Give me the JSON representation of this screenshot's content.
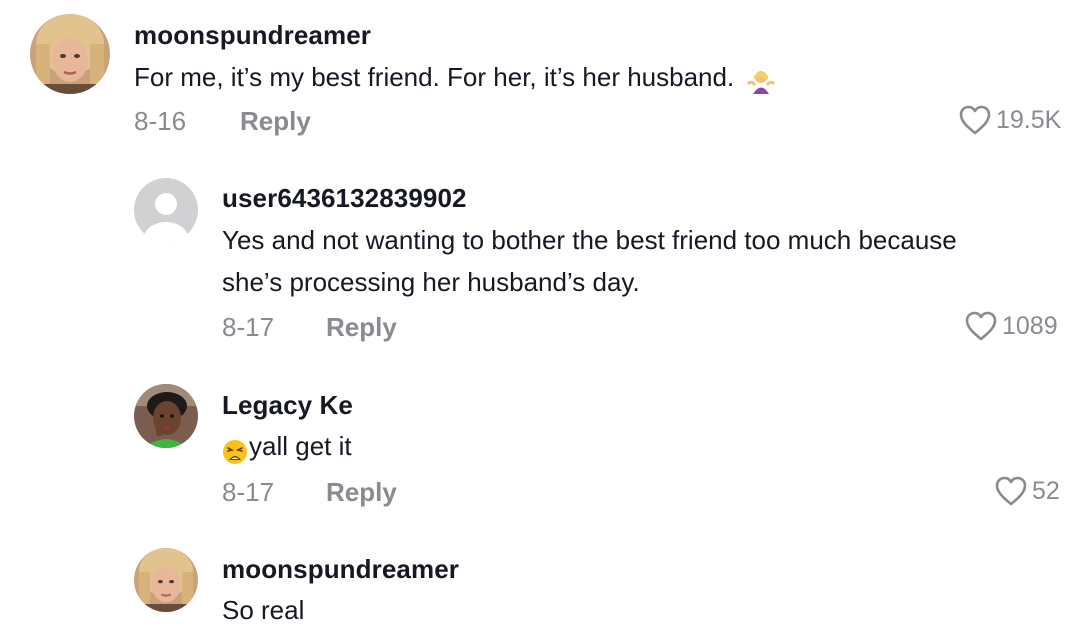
{
  "comments": [
    {
      "username": "moonspundreamer",
      "lines": [
        "For me, it’s my best friend. For her, it’s her husband."
      ],
      "emoji": "woman-shrugging",
      "date": "8-16",
      "reply_label": "Reply",
      "likes": "19.5K"
    },
    {
      "username": "user6436132839902",
      "lines": [
        "Yes and not wanting to bother the best friend too much because",
        "she’s processing her husband’s day."
      ],
      "date": "8-17",
      "reply_label": "Reply",
      "likes": "1089"
    },
    {
      "username": "Legacy Ke",
      "lines": [
        "yall get it"
      ],
      "emoji": "weary-face",
      "date": "8-17",
      "reply_label": "Reply",
      "likes": "52"
    },
    {
      "username": "moonspundreamer",
      "lines": [
        "So real"
      ]
    }
  ],
  "icons": {
    "like": "heart-outline-icon",
    "default_avatar": "default-user-avatar"
  },
  "colors": {
    "text": "#161823",
    "secondary": "#8a8b91"
  }
}
